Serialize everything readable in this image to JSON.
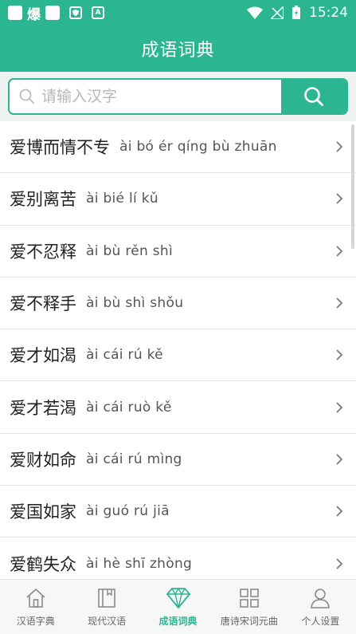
{
  "status_bar": {
    "glyph": "爆",
    "time": "15:24",
    "icons": [
      "square-icon",
      "shield-icon",
      "a-icon",
      "wifi-icon",
      "signal-icon",
      "battery-icon"
    ]
  },
  "header": {
    "title": "成语词典"
  },
  "search": {
    "placeholder": "请输入汉字",
    "value": ""
  },
  "idioms": [
    {
      "word": "爱博而情不专",
      "pinyin": "ài bó ér qíng bù zhuān"
    },
    {
      "word": "爱别离苦",
      "pinyin": "ài bié lí kǔ"
    },
    {
      "word": "爱不忍释",
      "pinyin": "ài bù rěn shì"
    },
    {
      "word": "爱不释手",
      "pinyin": "ài bù shì shǒu"
    },
    {
      "word": "爱才如渴",
      "pinyin": "ài cái rú kě"
    },
    {
      "word": "爱才若渴",
      "pinyin": "ài cái ruò kě"
    },
    {
      "word": "爱财如命",
      "pinyin": "ài cái rú mìng"
    },
    {
      "word": "爱国如家",
      "pinyin": "ài guó rú jiā"
    },
    {
      "word": "爱鹤失众",
      "pinyin": "ài hè shī zhòng"
    }
  ],
  "bottom_nav": [
    {
      "label": "汉语字典",
      "icon": "house-icon",
      "active": false
    },
    {
      "label": "现代汉语",
      "icon": "book-icon",
      "active": false
    },
    {
      "label": "成语词典",
      "icon": "diamond-icon",
      "active": true
    },
    {
      "label": "唐诗宋词元曲",
      "icon": "grid-icon",
      "active": false
    },
    {
      "label": "个人设置",
      "icon": "person-icon",
      "active": false
    }
  ],
  "colors": {
    "accent": "#2bb591",
    "inactive": "#666666"
  }
}
